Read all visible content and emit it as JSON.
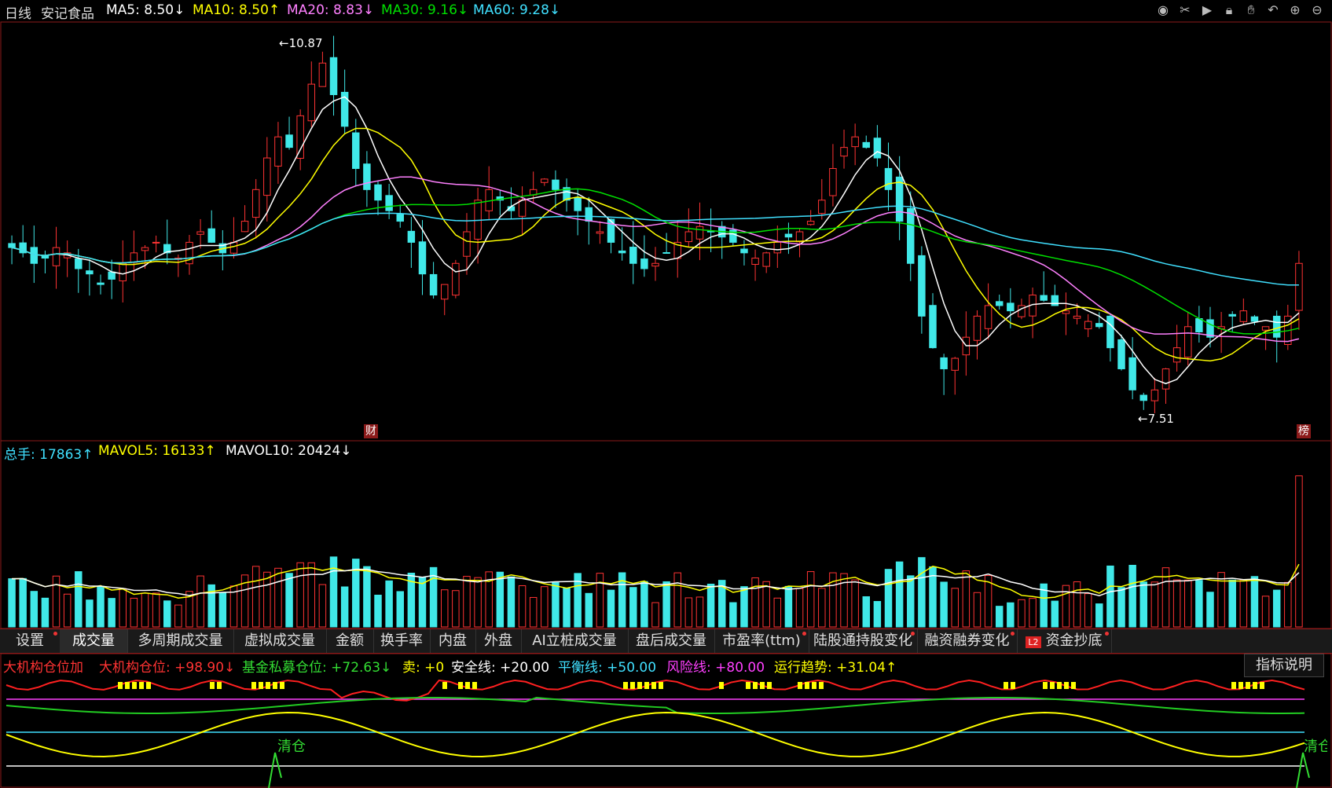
{
  "header": {
    "period": "日线",
    "stock_name": "安记食品",
    "ma5": "MA5: 8.50↓",
    "ma10": "MA10: 8.50↑",
    "ma20": "MA20: 8.83↓",
    "ma30": "MA30: 9.16↓",
    "ma60": "MA60: 9.28↓",
    "colors": {
      "ma5": "#ffffff",
      "ma10": "#ffff00",
      "ma20": "#ff80ff",
      "ma30": "#00e000",
      "ma60": "#40e0ff"
    }
  },
  "toolbar_icons": [
    "eye-icon",
    "scissors-icon",
    "play-icon",
    "lock-icon",
    "hand-icon",
    "undo-icon",
    "zoom-in-icon",
    "zoom-out-icon"
  ],
  "price_panel": {
    "high_label": "10.87",
    "low_label": "7.51",
    "marker_left": "财",
    "marker_right": "榜"
  },
  "volume_panel": {
    "total": "总手: 17863↑",
    "mavol5": "MAVOL5: 16133↑",
    "mavol10": "MAVOL10: 20424↓"
  },
  "tabs": [
    {
      "label": "设置",
      "dot": true
    },
    {
      "label": "成交量",
      "dot": false,
      "active": true
    },
    {
      "label": "多周期成交量",
      "dot": false
    },
    {
      "label": "虚拟成交量",
      "dot": false
    },
    {
      "label": "金额",
      "dot": false
    },
    {
      "label": "换手率",
      "dot": false
    },
    {
      "label": "内盘",
      "dot": false
    },
    {
      "label": "外盘",
      "dot": false
    },
    {
      "label": "AI立桩成交量",
      "dot": false
    },
    {
      "label": "盘后成交量",
      "dot": false
    },
    {
      "label": "市盈率(ttm)",
      "dot": true
    },
    {
      "label": "陆股通持股变化",
      "dot": true
    },
    {
      "label": "融资融券变化",
      "dot": true
    },
    {
      "label": "资金抄底",
      "dot": true,
      "badge": "L2"
    }
  ],
  "indicator": {
    "name": "大机构仓位加",
    "i1": "大机构仓位: +98.90↓",
    "i2": "基金私募仓位: +72.63↓",
    "i3": "卖: +0",
    "i4": "安全线: +20.00",
    "i5": "平衡线: +50.00",
    "i6": "风险线: +80.00",
    "i7": "运行趋势: +31.04↑",
    "help": "指标说明",
    "signal1": "清仓",
    "signal2": "清仓"
  },
  "chart_data": {
    "type": "candlestick",
    "price_ylim": [
      7.3,
      11.1
    ],
    "high": 10.87,
    "low": 7.51,
    "closes": [
      9.05,
      9.0,
      8.9,
      8.95,
      9.05,
      9.0,
      8.85,
      8.8,
      8.7,
      8.75,
      8.9,
      9.0,
      9.05,
      9.1,
      9.0,
      8.95,
      9.1,
      9.2,
      9.1,
      9.0,
      9.1,
      9.3,
      9.6,
      9.9,
      10.1,
      10.0,
      10.3,
      10.6,
      10.8,
      10.5,
      10.2,
      9.8,
      9.6,
      9.5,
      9.4,
      9.3,
      9.1,
      8.8,
      8.6,
      8.7,
      8.9,
      9.2,
      9.5,
      9.6,
      9.5,
      9.4,
      9.5,
      9.6,
      9.7,
      9.6,
      9.5,
      9.4,
      9.3,
      9.2,
      9.1,
      9.0,
      8.9,
      8.85,
      8.9,
      9.0,
      9.1,
      9.2,
      9.25,
      9.2,
      9.15,
      9.1,
      9.0,
      8.95,
      9.0,
      9.1,
      9.15,
      9.2,
      9.3,
      9.5,
      9.8,
      10.0,
      10.1,
      10.0,
      9.9,
      9.6,
      9.3,
      8.9,
      8.4,
      8.1,
      7.9,
      8.0,
      8.2,
      8.4,
      8.5,
      8.5,
      8.45,
      8.5,
      8.6,
      8.55,
      8.5,
      8.45,
      8.4,
      8.35,
      8.3,
      8.1,
      7.9,
      7.7,
      7.6,
      7.7,
      7.9,
      8.1,
      8.3,
      8.25,
      8.2,
      8.3,
      8.4,
      8.45,
      8.35,
      8.3,
      8.2,
      8.4,
      8.9
    ],
    "volume_ylim": [
      0,
      130000
    ],
    "series": [
      {
        "name": "MA5",
        "value": 8.5
      },
      {
        "name": "MA10",
        "value": 8.5
      },
      {
        "name": "MA20",
        "value": 8.83
      },
      {
        "name": "MA30",
        "value": 9.16
      },
      {
        "name": "MA60",
        "value": 9.28
      }
    ]
  }
}
